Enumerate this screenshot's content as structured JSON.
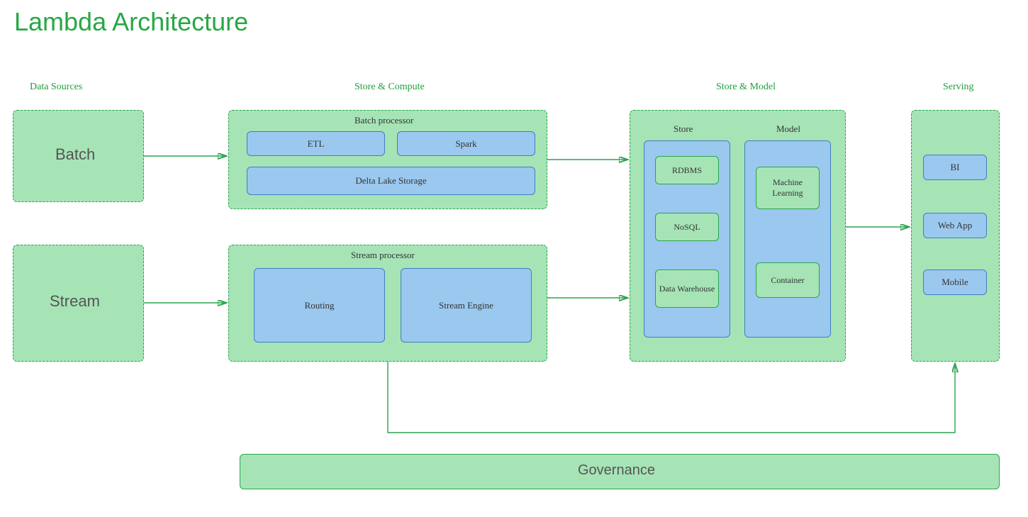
{
  "title": "Lambda Architecture",
  "sections": {
    "dataSources": "Data Sources",
    "storeCompute": "Store & Compute",
    "storeModel": "Store & Model",
    "serving": "Serving"
  },
  "sources": {
    "batch": "Batch",
    "stream": "Stream"
  },
  "batchProcessor": {
    "title": "Batch processor",
    "etl": "ETL",
    "spark": "Spark",
    "delta": "Delta Lake Storage"
  },
  "streamProcessor": {
    "title": "Stream processor",
    "routing": "Routing",
    "engine": "Stream Engine"
  },
  "storeModel": {
    "storeTitle": "Store",
    "modelTitle": "Model",
    "rdbms": "RDBMS",
    "nosql": "NoSQL",
    "dw": "Data Warehouse",
    "ml": "Machine Learning",
    "container": "Container"
  },
  "serving": {
    "bi": "BI",
    "web": "Web App",
    "mobile": "Mobile"
  },
  "governance": "Governance",
  "colors": {
    "green": "#a6e4b6",
    "greenBorder": "#2aa44f",
    "blue": "#9bc8ef",
    "blueBorder": "#3f7fbf",
    "titleGreen": "#28a745"
  }
}
